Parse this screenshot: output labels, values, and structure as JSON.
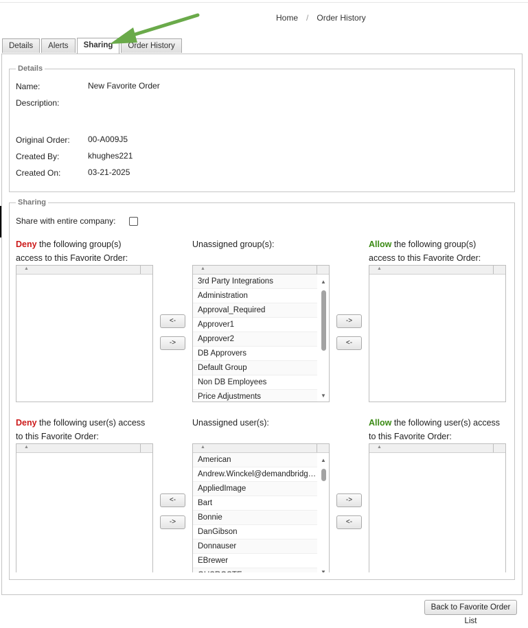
{
  "breadcrumb": {
    "home": "Home",
    "separator": "/",
    "current": "Order History"
  },
  "tabs": [
    {
      "label": "Details",
      "active": false
    },
    {
      "label": "Alerts",
      "active": false
    },
    {
      "label": "Sharing",
      "active": true
    },
    {
      "label": "Order History",
      "active": false
    }
  ],
  "details": {
    "legend": "Details",
    "name_label": "Name:",
    "name_value": "New Favorite Order",
    "description_label": "Description:",
    "description_value": "",
    "original_order_label": "Original Order:",
    "original_order_value": "00-A009J5",
    "created_by_label": "Created By:",
    "created_by_value": "khughes221",
    "created_on_label": "Created On:",
    "created_on_value": "03-21-2025"
  },
  "sharing": {
    "legend": "Sharing",
    "share_company_label": "Share with entire company:",
    "share_company_checked": false,
    "groups": {
      "deny_word": "Deny",
      "deny_rest_1": " the following group(s)",
      "deny_rest_2": "access to this Favorite Order:",
      "unassigned_label": "Unassigned group(s):",
      "allow_word": "Allow",
      "allow_rest_1": " the following group(s)",
      "allow_rest_2": "access to this Favorite Order:",
      "unassigned_items": [
        "3rd Party Integrations",
        "Administration",
        "Approval_Required",
        "Approver1",
        "Approver2",
        "DB Approvers",
        "Default Group",
        "Non DB Employees",
        "Price Adjustments"
      ],
      "deny_items": [],
      "allow_items": []
    },
    "users": {
      "deny_word": "Deny",
      "deny_rest_1": " the following user(s) access",
      "deny_rest_2": "to this Favorite Order:",
      "unassigned_label": "Unassigned user(s):",
      "allow_word": "Allow",
      "allow_rest_1": " the following user(s) access",
      "allow_rest_2": "to this Favorite Order:",
      "unassigned_items": [
        "American",
        "Andrew.Winckel@demandbridge.com",
        "AppliedImage",
        "Bart",
        "Bonnie",
        "DanGibson",
        "Donnauser",
        "EBrewer",
        "GUSROSTE"
      ],
      "deny_items": [],
      "allow_items": []
    },
    "move_left": "<-",
    "move_right": "->"
  },
  "footer": {
    "back_label": "Back to Favorite Order List"
  },
  "colors": {
    "deny": "#cc1a1a",
    "allow": "#3a8a13",
    "arrow": "#6aaa4a"
  }
}
